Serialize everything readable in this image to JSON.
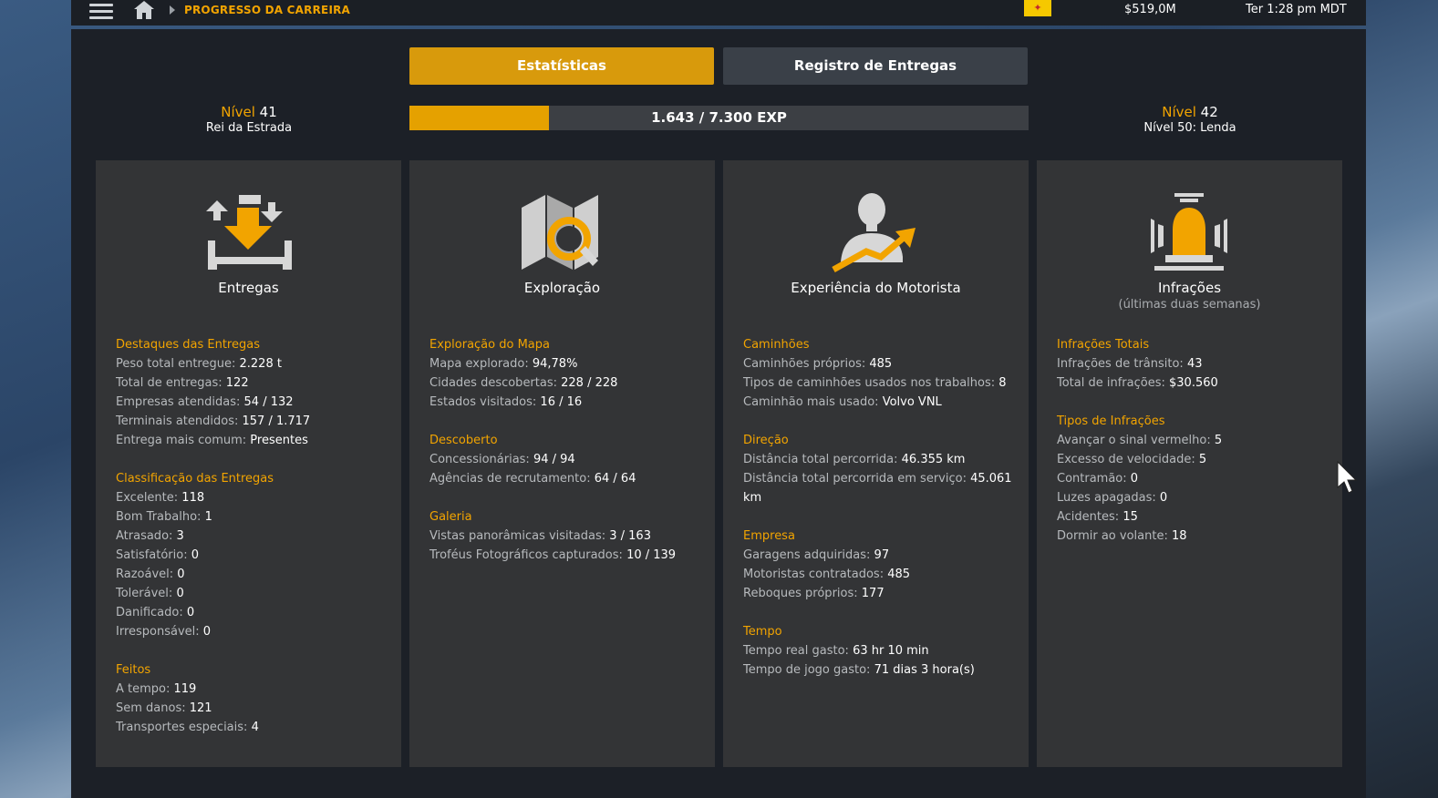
{
  "header": {
    "breadcrumb": "PROGRESSO DA CARREIRA",
    "money": "$519,0M",
    "clock": "Ter 1:28 pm MDT",
    "icons": [
      "menu-icon",
      "home-icon",
      "flag-icon"
    ]
  },
  "tabs": [
    {
      "label": "Estatísticas",
      "active": true
    },
    {
      "label": "Registro de Entregas",
      "active": false
    }
  ],
  "level": {
    "current_word": "Nível",
    "current_num": "41",
    "current_title": "Rei da Estrada",
    "next_word": "Nível",
    "next_num": "42",
    "next_title": "Nível 50: Lenda",
    "xp_text": "1.643 / 7.300 EXP",
    "xp_fraction": 0.225
  },
  "colors": {
    "accent": "#f2a400",
    "tab_active": "#d89a0c",
    "card_bg": "#333436"
  },
  "cards": [
    {
      "title": "Entregas",
      "icon": "deliveries-icon",
      "sections": [
        {
          "title": "Destaques das Entregas",
          "stats": [
            {
              "label": "Peso total entregue:",
              "value": "2.228 t"
            },
            {
              "label": "Total de entregas:",
              "value": "122"
            },
            {
              "label": "Empresas atendidas:",
              "value": "54 / 132"
            },
            {
              "label": "Terminais atendidos:",
              "value": "157 / 1.717"
            },
            {
              "label": "Entrega mais comum:",
              "value": "Presentes"
            }
          ]
        },
        {
          "title": "Classificação das Entregas",
          "stats": [
            {
              "label": "Excelente:",
              "value": "118"
            },
            {
              "label": "Bom Trabalho:",
              "value": "1"
            },
            {
              "label": "Atrasado:",
              "value": "3"
            },
            {
              "label": "Satisfatório:",
              "value": "0"
            },
            {
              "label": "Razoável:",
              "value": "0"
            },
            {
              "label": "Tolerável:",
              "value": "0"
            },
            {
              "label": "Danificado:",
              "value": "0"
            },
            {
              "label": "Irresponsável:",
              "value": "0"
            }
          ]
        },
        {
          "title": "Feitos",
          "stats": [
            {
              "label": "A tempo:",
              "value": "119"
            },
            {
              "label": "Sem danos:",
              "value": "121"
            },
            {
              "label": "Transportes especiais:",
              "value": "4"
            }
          ]
        }
      ]
    },
    {
      "title": "Exploração",
      "icon": "map-search-icon",
      "sections": [
        {
          "title": "Exploração do Mapa",
          "stats": [
            {
              "label": "Mapa explorado:",
              "value": "94,78%"
            },
            {
              "label": "Cidades descobertas:",
              "value": "228 / 228"
            },
            {
              "label": "Estados visitados:",
              "value": "16 / 16"
            }
          ]
        },
        {
          "title": "Descoberto",
          "stats": [
            {
              "label": "Concessionárias:",
              "value": "94 / 94"
            },
            {
              "label": "Agências de recrutamento:",
              "value": "64 / 64"
            }
          ]
        },
        {
          "title": "Galeria",
          "stats": [
            {
              "label": "Vistas panorâmicas visitadas:",
              "value": "3 / 163"
            },
            {
              "label": "Troféus Fotográficos capturados:",
              "value": "10 / 139"
            }
          ]
        }
      ]
    },
    {
      "title": "Experiência do Motorista",
      "icon": "driver-growth-icon",
      "sections": [
        {
          "title": "Caminhões",
          "stats": [
            {
              "label": "Caminhões próprios:",
              "value": "485"
            },
            {
              "label": "Tipos de caminhões usados nos trabalhos:",
              "value": "8"
            },
            {
              "label": "Caminhão mais usado:",
              "value": "Volvo VNL"
            }
          ]
        },
        {
          "title": "Direção",
          "stats": [
            {
              "label": "Distância total percorrida:",
              "value": "46.355 km"
            },
            {
              "label": "Distância total percorrida em serviço:",
              "value": "45.061 km"
            }
          ]
        },
        {
          "title": "Empresa",
          "stats": [
            {
              "label": "Garagens adquiridas:",
              "value": "97"
            },
            {
              "label": "Motoristas contratados:",
              "value": "485"
            },
            {
              "label": "Reboques próprios:",
              "value": "177"
            }
          ]
        },
        {
          "title": "Tempo",
          "stats": [
            {
              "label": "Tempo real gasto:",
              "value": "63 hr 10 min"
            },
            {
              "label": "Tempo de jogo gasto:",
              "value": "71 dias 3 hora(s)"
            }
          ]
        }
      ]
    },
    {
      "title": "Infrações",
      "subtitle": "(últimas duas semanas)",
      "icon": "siren-icon",
      "sections": [
        {
          "title": "Infrações Totais",
          "stats": [
            {
              "label": "Infrações de trânsito:",
              "value": "43"
            },
            {
              "label": "Total de infrações:",
              "value": "$30.560"
            }
          ]
        },
        {
          "title": "Tipos de Infrações",
          "stats": [
            {
              "label": "Avançar o sinal vermelho:",
              "value": "5"
            },
            {
              "label": "Excesso de velocidade:",
              "value": "5"
            },
            {
              "label": "Contramão:",
              "value": "0"
            },
            {
              "label": "Luzes apagadas:",
              "value": "0"
            },
            {
              "label": "Acidentes:",
              "value": "15"
            },
            {
              "label": "Dormir ao volante:",
              "value": "18"
            }
          ]
        }
      ]
    }
  ]
}
